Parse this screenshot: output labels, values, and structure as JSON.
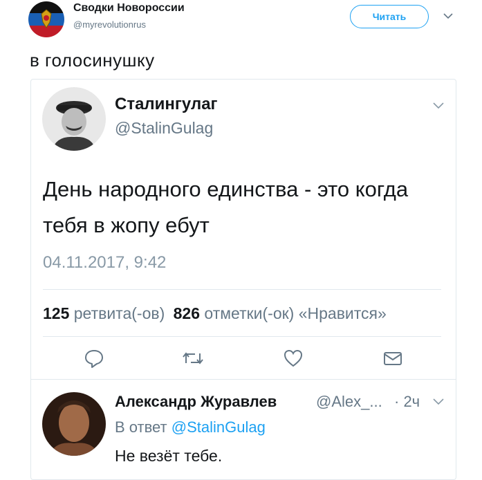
{
  "outer_tweet": {
    "author_name": "Сводки Новороссии",
    "author_handle": "@myrevolutionrus",
    "follow_label": "Читать",
    "text": "в голосинушку"
  },
  "quoted_tweet": {
    "author_name": "Сталингулаг",
    "author_handle": "@StalinGulag",
    "text": "День народного единства - это когда тебя в жопу ебут",
    "timestamp": "04.11.2017, 9:42",
    "retweets_count": "125",
    "retweets_label": "ретвита(-ов)",
    "likes_count": "826",
    "likes_label": "отметки(-ок) «Нравится»"
  },
  "reply": {
    "author_name": "Александр Журавлев",
    "author_handle": "@Alex_...",
    "time": "· 2ч",
    "in_reply_prefix": "В ответ",
    "in_reply_handle": "@StalinGulag",
    "text": "Не везёт тебе."
  },
  "colors": {
    "accent": "#1da1f2",
    "text": "#14171a",
    "muted": "#657786",
    "border": "#e1e8ed"
  },
  "icons": [
    "flag-avatar-icon",
    "chevron-down-icon",
    "reply-icon",
    "retweet-icon",
    "like-icon",
    "message-icon"
  ]
}
